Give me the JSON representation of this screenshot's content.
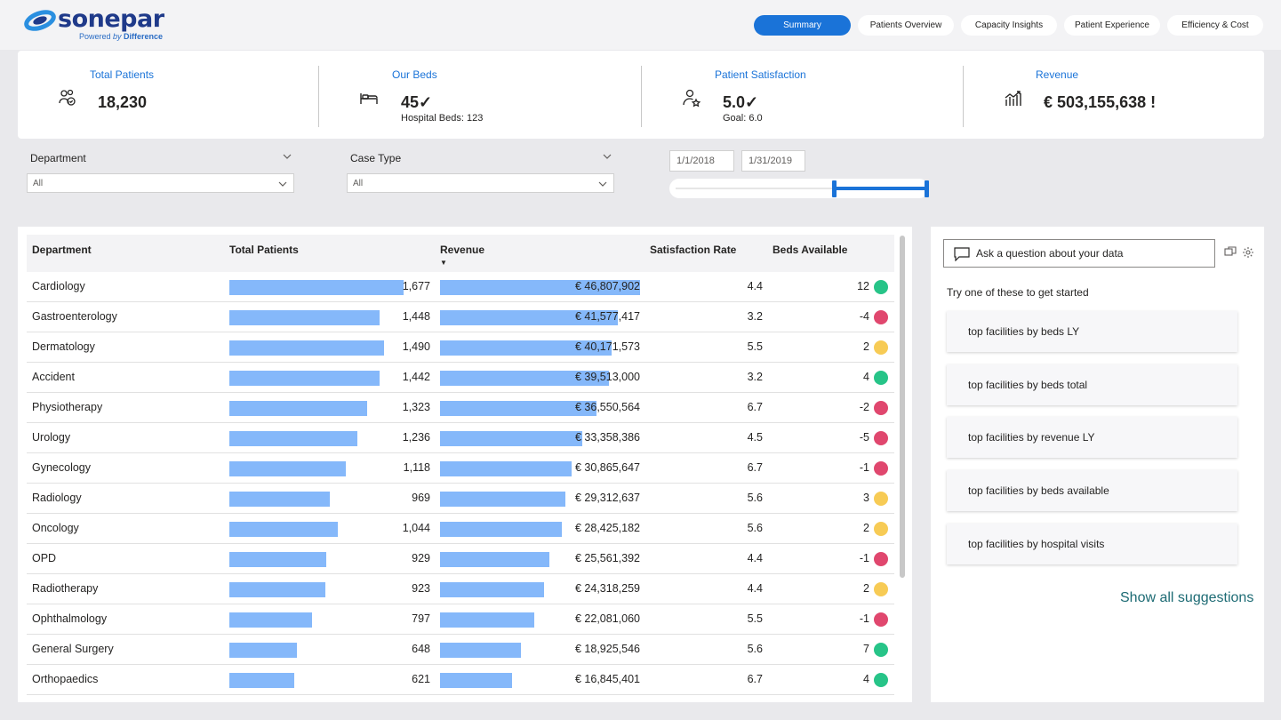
{
  "brand": {
    "name": "sonepar",
    "tagline_prefix": "Powered ",
    "tagline_by": "by ",
    "tagline_word": "Difference"
  },
  "nav": {
    "tabs": [
      {
        "label": "Summary",
        "active": true
      },
      {
        "label": "Patients Overview",
        "active": false
      },
      {
        "label": "Capacity Insights",
        "active": false
      },
      {
        "label": "Patient Experience",
        "active": false
      },
      {
        "label": "Efficiency & Cost",
        "active": false
      }
    ]
  },
  "kpis": {
    "total_patients": {
      "title": "Total Patients",
      "value": "18,230",
      "icon": "patients-icon"
    },
    "our_beds": {
      "title": "Our Beds",
      "value": "45✓",
      "sub": "Hospital Beds: 123",
      "icon": "bed-icon"
    },
    "satisfaction": {
      "title": "Patient Satisfaction",
      "value": "5.0✓",
      "sub": "Goal: 6.0",
      "icon": "person-star-icon"
    },
    "revenue": {
      "title": "Revenue",
      "value": "€ 503,155,638 !",
      "icon": "growth-chart-icon"
    }
  },
  "filters": {
    "department": {
      "label": "Department",
      "value": "All"
    },
    "case_type": {
      "label": "Case Type",
      "value": "All"
    },
    "date_range": {
      "start": "1/1/2018",
      "end": "1/31/2019"
    }
  },
  "table": {
    "columns": [
      "Department",
      "Total Patients",
      "Revenue",
      "Satisfaction Rate",
      "Beds Available"
    ],
    "sort_indicator": "▼",
    "rows": [
      {
        "department": "Cardiology",
        "patients": 1677,
        "patients_label": "1,677",
        "revenue": 46807902,
        "revenue_label": "€ 46,807,902",
        "satisfaction": "4.4",
        "beds": "12",
        "status": "green"
      },
      {
        "department": "Gastroenterology",
        "patients": 1448,
        "patients_label": "1,448",
        "revenue": 41577417,
        "revenue_label": "€ 41,577,417",
        "satisfaction": "3.2",
        "beds": "-4",
        "status": "red"
      },
      {
        "department": "Dermatology",
        "patients": 1490,
        "patients_label": "1,490",
        "revenue": 40171573,
        "revenue_label": "€ 40,171,573",
        "satisfaction": "5.5",
        "beds": "2",
        "status": "yellow"
      },
      {
        "department": "Accident",
        "patients": 1442,
        "patients_label": "1,442",
        "revenue": 39513000,
        "revenue_label": "€ 39,513,000",
        "satisfaction": "3.2",
        "beds": "4",
        "status": "green"
      },
      {
        "department": "Physiotherapy",
        "patients": 1323,
        "patients_label": "1,323",
        "revenue": 36550564,
        "revenue_label": "€ 36,550,564",
        "satisfaction": "6.7",
        "beds": "-2",
        "status": "red"
      },
      {
        "department": "Urology",
        "patients": 1236,
        "patients_label": "1,236",
        "revenue": 33358386,
        "revenue_label": "€ 33,358,386",
        "satisfaction": "4.5",
        "beds": "-5",
        "status": "red"
      },
      {
        "department": "Gynecology",
        "patients": 1118,
        "patients_label": "1,118",
        "revenue": 30865647,
        "revenue_label": "€ 30,865,647",
        "satisfaction": "6.7",
        "beds": "-1",
        "status": "red"
      },
      {
        "department": "Radiology",
        "patients": 969,
        "patients_label": "969",
        "revenue": 29312637,
        "revenue_label": "€ 29,312,637",
        "satisfaction": "5.6",
        "beds": "3",
        "status": "yellow"
      },
      {
        "department": "Oncology",
        "patients": 1044,
        "patients_label": "1,044",
        "revenue": 28425182,
        "revenue_label": "€ 28,425,182",
        "satisfaction": "5.6",
        "beds": "2",
        "status": "yellow"
      },
      {
        "department": "OPD",
        "patients": 929,
        "patients_label": "929",
        "revenue": 25561392,
        "revenue_label": "€ 25,561,392",
        "satisfaction": "4.4",
        "beds": "-1",
        "status": "red"
      },
      {
        "department": "Radiotherapy",
        "patients": 923,
        "patients_label": "923",
        "revenue": 24318259,
        "revenue_label": "€ 24,318,259",
        "satisfaction": "4.4",
        "beds": "2",
        "status": "yellow"
      },
      {
        "department": "Ophthalmology",
        "patients": 797,
        "patients_label": "797",
        "revenue": 22081060,
        "revenue_label": "€ 22,081,060",
        "satisfaction": "5.5",
        "beds": "-1",
        "status": "red"
      },
      {
        "department": "General Surgery",
        "patients": 648,
        "patients_label": "648",
        "revenue": 18925546,
        "revenue_label": "€ 18,925,546",
        "satisfaction": "5.6",
        "beds": "7",
        "status": "green"
      },
      {
        "department": "Orthopaedics",
        "patients": 621,
        "patients_label": "621",
        "revenue": 16845401,
        "revenue_label": "€ 16,845,401",
        "satisfaction": "6.7",
        "beds": "4",
        "status": "green"
      }
    ],
    "bar_color": "#85b8fa",
    "status_colors": {
      "green": "#27c488",
      "red": "#e0476e",
      "yellow": "#f7cb55"
    }
  },
  "qa": {
    "placeholder": "Ask a question about your data",
    "hint": "Try one of these to get started",
    "suggestions": [
      "top facilities by beds LY",
      "top facilities by beds total",
      "top facilities by revenue LY",
      "top facilities by beds available",
      "top facilities by hospital visits"
    ],
    "show_all": "Show all suggestions"
  },
  "colors": {
    "accent": "#1a73d8",
    "brand": "#1f3a8a",
    "link_teal": "#1d6b74"
  }
}
